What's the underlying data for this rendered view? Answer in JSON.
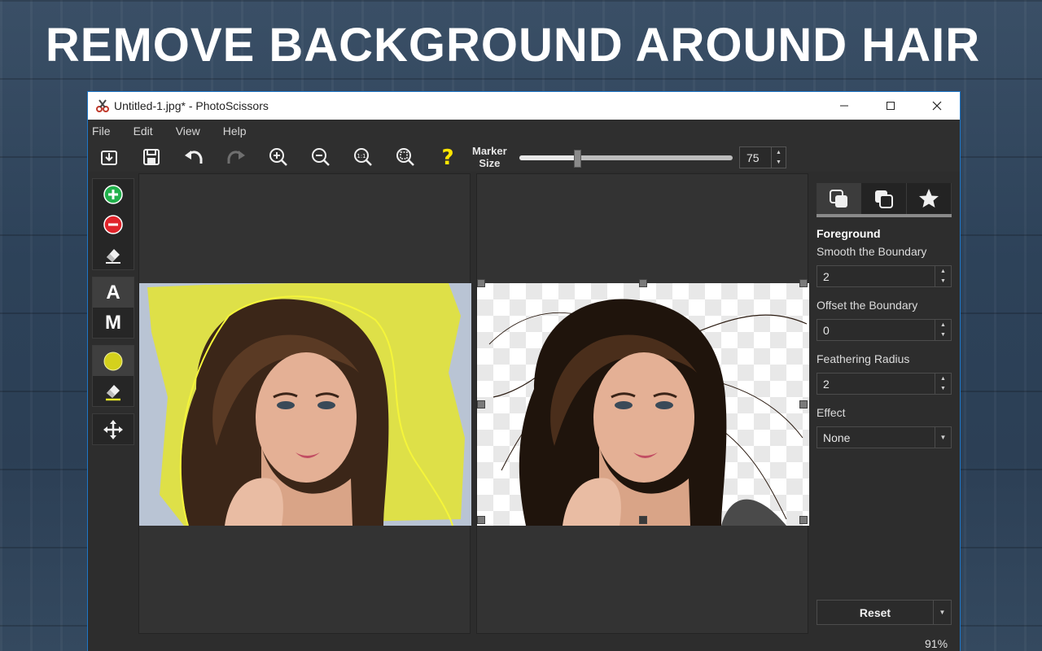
{
  "headline": "REMOVE BACKGROUND AROUND HAIR",
  "window": {
    "title": "Untitled-1.jpg* - PhotoScissors",
    "controls": [
      "minimize-icon",
      "maximize-icon",
      "close-icon"
    ]
  },
  "menu": {
    "items": [
      "File",
      "Edit",
      "View",
      "Help"
    ]
  },
  "toolbar": {
    "buttons": [
      "open-icon",
      "save-icon",
      "undo-icon",
      "redo-icon",
      "zoom-in-icon",
      "zoom-out-icon",
      "zoom-actual-icon",
      "zoom-fit-icon",
      "help-icon"
    ],
    "marker_size_label_line1": "Marker",
    "marker_size_label_line2": "Size",
    "marker_size_value": "75",
    "marker_size_fraction": 0.27
  },
  "left_tools": {
    "group1": [
      "add-foreground-marker-icon",
      "add-background-marker-icon",
      "eraser-icon"
    ],
    "mode_auto": "A",
    "mode_manual": "M",
    "group3": [
      "hair-marker-icon",
      "hair-eraser-icon"
    ],
    "group4": [
      "move-icon"
    ]
  },
  "colors": {
    "accent_yellow": "#e6e62a",
    "add_green": "#22b14c",
    "remove_red": "#e0242b",
    "help_yellow": "#ffe600"
  },
  "right_panel": {
    "tabs": [
      "foreground-tab-icon",
      "background-tab-icon",
      "effects-tab-icon"
    ],
    "heading": "Foreground",
    "smooth_label": "Smooth the Boundary",
    "smooth_value": "2",
    "offset_label": "Offset the Boundary",
    "offset_value": "0",
    "feather_label": "Feathering Radius",
    "feather_value": "2",
    "effect_label": "Effect",
    "effect_value": "None",
    "reset_label": "Reset"
  },
  "status": {
    "zoom": "91%"
  }
}
